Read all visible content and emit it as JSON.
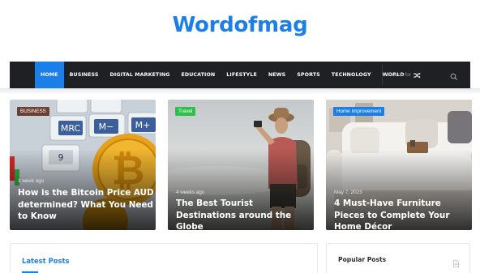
{
  "site": {
    "title": "Wordofmag"
  },
  "nav": {
    "items": [
      {
        "label": "HOME"
      },
      {
        "label": "BUSINESS"
      },
      {
        "label": "DIGITAL MARKETING"
      },
      {
        "label": "EDUCATION"
      },
      {
        "label": "LIFESTYLE"
      },
      {
        "label": "NEWS"
      },
      {
        "label": "SPORTS"
      },
      {
        "label": "TECHNOLOGY"
      },
      {
        "label": "WORLD"
      }
    ],
    "search_placeholder": "Search for",
    "random_icon": "shuffle-icon",
    "search_icon": "search-icon"
  },
  "featured": [
    {
      "badge": "BUSINESS",
      "badge_color": "#6b3f32",
      "date": "1 week ago",
      "title": "How is the Bitcoin Price AUD determined? What You Need to Know"
    },
    {
      "badge": "Travel",
      "badge_color": "#2fbf4a",
      "date": "4 weeks ago",
      "title": "The Best Tourist Destinations around the Globe"
    },
    {
      "badge": "Home Improvement",
      "badge_color": "#1b7fe9",
      "date": "May 7, 2023",
      "title": "4 Must-Have Furniture Pieces to Complete Your Home Décor"
    }
  ],
  "sections": {
    "latest_posts": "Latest Posts",
    "popular_posts": "Popular Posts"
  },
  "colors": {
    "accent": "#1b7fe9",
    "nav_bg": "#1f2024"
  }
}
